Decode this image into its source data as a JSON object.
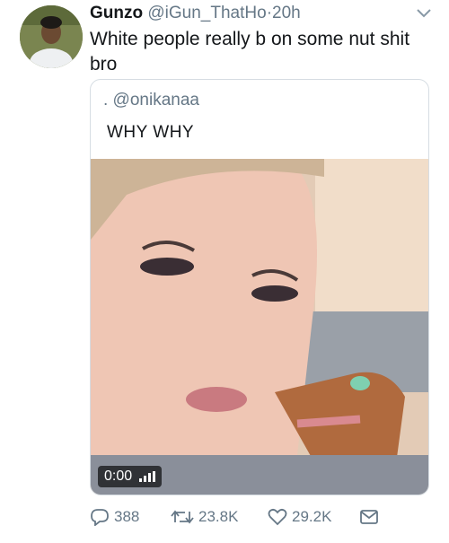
{
  "tweet": {
    "name": "Gunzo",
    "handle": "@iGun_ThatHo",
    "separator": "·",
    "time": "20h",
    "text": "White people really b on some nut shit bro"
  },
  "quoted": {
    "handle": ". @onikanaa",
    "text": "WHY WHY",
    "video_time": "0:00"
  },
  "actions": {
    "replies": "388",
    "retweets": "23.8K",
    "likes": "29.2K"
  }
}
